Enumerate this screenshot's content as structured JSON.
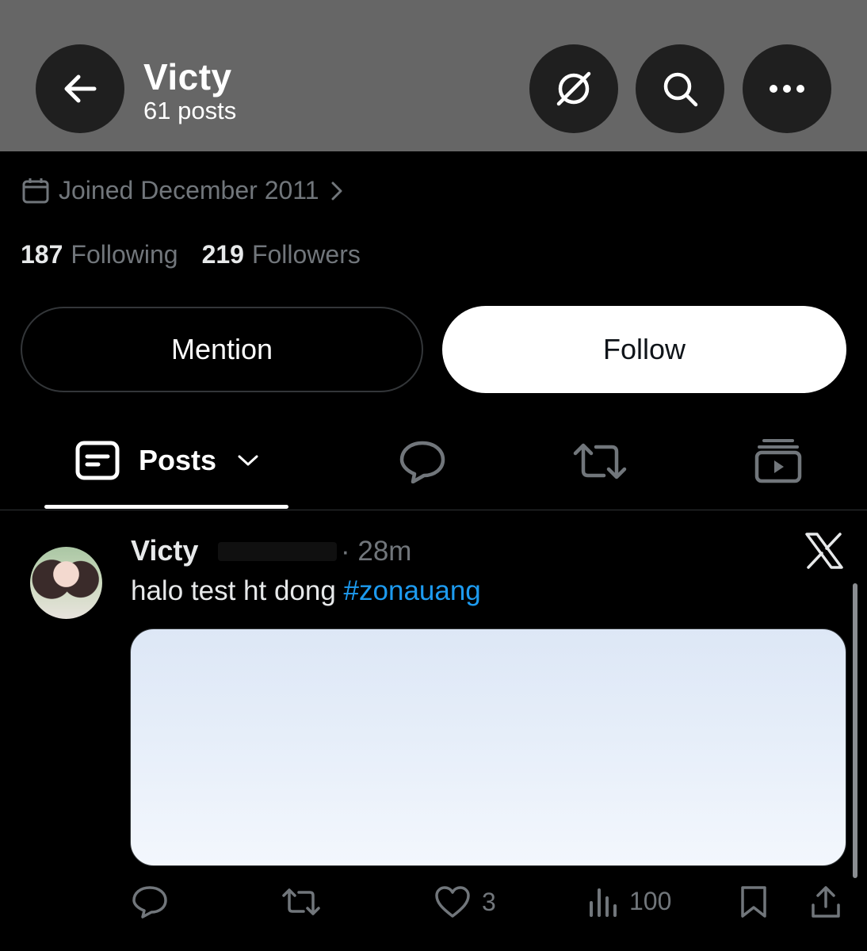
{
  "header": {
    "back_icon": "arrow-left-icon",
    "name": "Victy",
    "post_count": "61 posts",
    "grok_icon": "grok-slash-icon",
    "search_icon": "search-icon",
    "more_icon": "more-horizontal-icon"
  },
  "profile": {
    "joined": "Joined December 2011",
    "following_count": "187",
    "following_label": "Following",
    "followers_count": "219",
    "followers_label": "Followers"
  },
  "buttons": {
    "mention": "Mention",
    "follow": "Follow"
  },
  "tabs": {
    "posts_label": "Posts",
    "replies_icon": "chat-bubble-icon",
    "reposts_icon": "repost-icon",
    "media_icon": "video-stack-icon"
  },
  "post": {
    "author": "Victy",
    "time": "· 28m",
    "text": "halo test ht dong ",
    "hashtag": "#zonauang",
    "likes": "3",
    "views": "100"
  },
  "colors": {
    "header_bg": "#666666",
    "background": "#000000",
    "hashtag": "#1d9bf0",
    "muted": "#71767b"
  }
}
